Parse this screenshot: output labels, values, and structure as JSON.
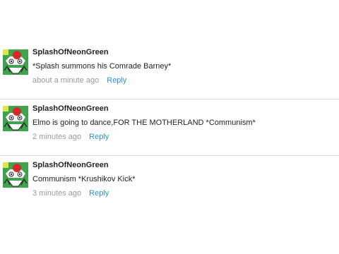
{
  "comments": [
    {
      "username": "SplashOfNeonGreen",
      "text": "*Splash summons his Comrade Barney*",
      "timestamp": "about a minute ago",
      "reply_label": "Reply",
      "avatar_icon": "monster-avatar"
    },
    {
      "username": "SplashOfNeonGreen",
      "text": "Elmo is going to dance,FOR THE MOTHERLAND *Communism*",
      "timestamp": "2 minutes ago",
      "reply_label": "Reply",
      "avatar_icon": "monster-avatar"
    },
    {
      "username": "SplashOfNeonGreen",
      "text": "Communism *Krushikov Kick*",
      "timestamp": "3 minutes ago",
      "reply_label": "Reply",
      "avatar_icon": "monster-avatar"
    }
  ],
  "colors": {
    "link": "#2a8fd8",
    "muted": "#999999",
    "avatar_green": "#3fa34d",
    "avatar_red": "#d42a2a"
  }
}
